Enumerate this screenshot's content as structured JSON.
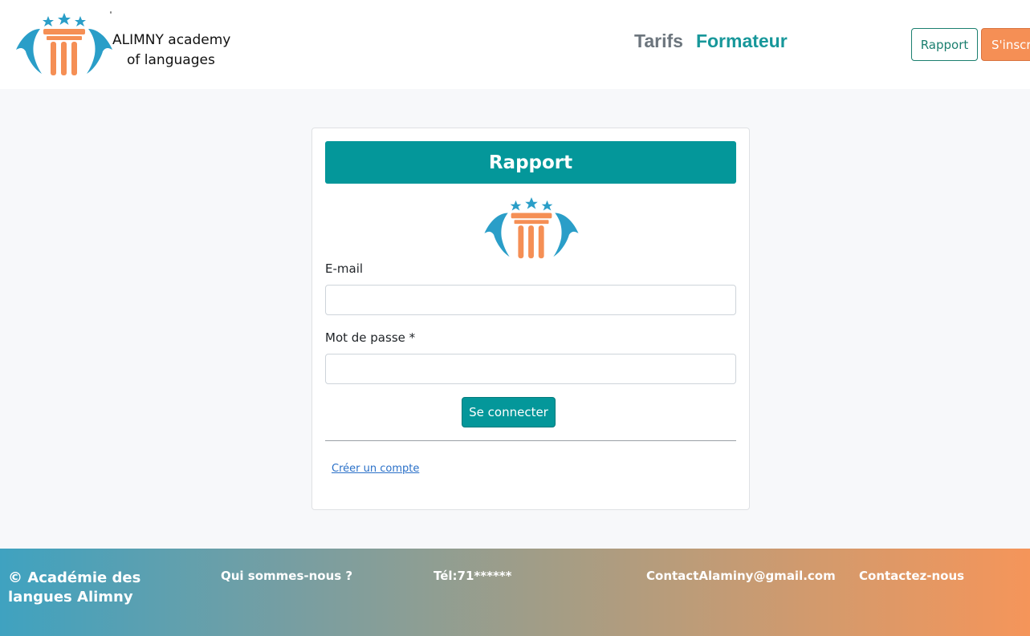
{
  "header": {
    "brand_line1": "ALIMNY academy",
    "brand_line2": "of languages",
    "nav": {
      "tarifs": "Tarifs",
      "formateur": "Formateur"
    },
    "buttons": {
      "rapport": "Rapport",
      "inscrire": "S'inscrire"
    }
  },
  "login_card": {
    "title": "Rapport",
    "email_label": "E-mail",
    "email_value": "",
    "password_label": "Mot de passe *",
    "password_value": "",
    "submit_label": "Se connecter",
    "create_account_link": "Créer un compte"
  },
  "footer": {
    "copyright": "© Académie des langues Alimny",
    "about": "Qui sommes-nous ?",
    "phone": "Tél:71******",
    "email": "ContactAlaminy@gmail.com",
    "contact": "Contactez-nous"
  },
  "colors": {
    "teal": "#04979a",
    "orange": "#f58f55",
    "blue": "#2a9ec8"
  }
}
